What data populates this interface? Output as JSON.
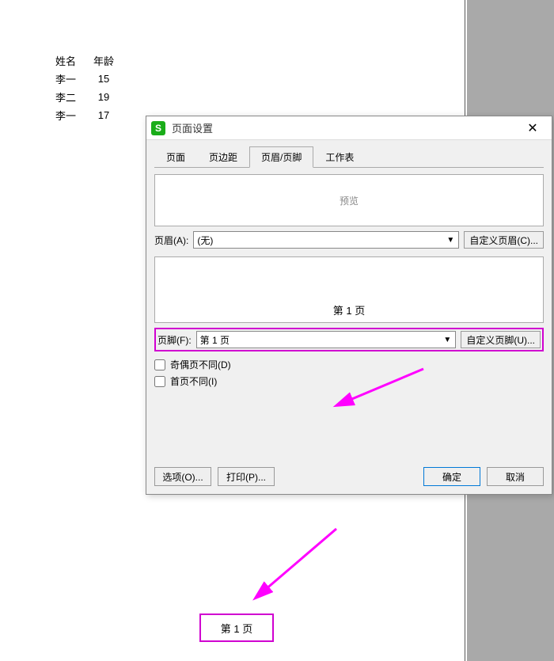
{
  "sheet": {
    "headers": [
      "姓名",
      "年龄"
    ],
    "rows": [
      [
        "李一",
        "15"
      ],
      [
        "李二",
        "19"
      ],
      [
        "李一",
        "17"
      ]
    ]
  },
  "dialog": {
    "title": "页面设置",
    "close_glyph": "✕",
    "tabs": [
      "页面",
      "页边距",
      "页眉/页脚",
      "工作表"
    ],
    "active_tab_index": 2,
    "preview_label": "预览",
    "header_label": "页眉(A):",
    "header_value": "(无)",
    "custom_header_btn": "自定义页眉(C)...",
    "footer_preview_text": "第 1 页",
    "footer_label": "页脚(F):",
    "footer_value": "第 1 页",
    "custom_footer_btn": "自定义页脚(U)...",
    "check_odd_even": "奇偶页不同(D)",
    "check_first": "首页不同(I)",
    "options_btn": "选项(O)...",
    "print_btn": "打印(P)...",
    "ok_btn": "确定",
    "cancel_btn": "取消"
  },
  "page_footer": "第 1 页"
}
